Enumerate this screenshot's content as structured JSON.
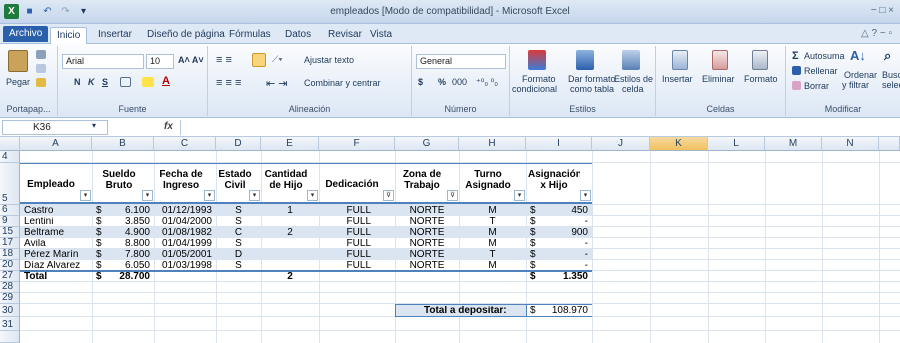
{
  "window": {
    "title": "empleados  [Modo de compatibilidad]  -  Microsoft Excel",
    "controls": "− □ ×"
  },
  "qat": {
    "excel_logo": "X",
    "save": "■",
    "undo": "↶",
    "redo": "↷",
    "customize": "▾"
  },
  "tabs": [
    "Archivo",
    "Inicio",
    "Insertar",
    "Diseño de página",
    "Fórmulas",
    "Datos",
    "Revisar",
    "Vista"
  ],
  "active_tab": "Inicio",
  "ribbon": {
    "groups": {
      "clipboard": "Portapap...",
      "font": "Fuente",
      "alignment": "Alineación",
      "number": "Número",
      "styles": "Estilos",
      "cells": "Celdas",
      "edit": "Modificar"
    },
    "paste": "Pegar",
    "font_name": "Arial",
    "font_size": "10",
    "bold": "N",
    "italic": "K",
    "underline": "S",
    "wrap_text": "Ajustar texto",
    "merge_center": "Combinar y centrar",
    "number_format": "General",
    "currency": "$",
    "percent": "%",
    "thousands": "000",
    "conditional_format_1": "Formato",
    "conditional_format_2": "condicional",
    "format_table_1": "Dar formato",
    "format_table_2": "como tabla",
    "cell_styles_1": "Estilos de",
    "cell_styles_2": "celda",
    "insert": "Insertar",
    "delete": "Eliminar",
    "format": "Formato",
    "autosum": "Autosuma",
    "fill": "Rellenar",
    "clear": "Borrar",
    "sort_1": "Ordenar",
    "sort_2": "y filtrar",
    "find_1": "Buscar y",
    "find_2": "seleccionar"
  },
  "formula_bar": {
    "name_box": "K36",
    "fx": "fx",
    "value": ""
  },
  "columns": [
    "A",
    "B",
    "C",
    "D",
    "E",
    "F",
    "G",
    "H",
    "I",
    "J",
    "K",
    "L",
    "M",
    "N"
  ],
  "selected_column": "K",
  "rows": [
    "4",
    "5",
    "6",
    "9",
    "15",
    "17",
    "18",
    "20",
    "27",
    "28",
    "29",
    "30",
    "31"
  ],
  "table": {
    "headers": [
      "Empleado",
      "Sueldo Bruto",
      "Fecha de Ingreso",
      "Estado Civil",
      "Cantidad de Hijo",
      "Dedicación",
      "Zona de Trabajo",
      "Turno Asignado",
      "Asignación x Hijo"
    ],
    "data": [
      {
        "row": "6",
        "empleado": "Castro",
        "sueldo": "6.100",
        "fecha": "01/12/1993",
        "estado": "S",
        "hijos": "1",
        "dedicacion": "FULL",
        "zona": "NORTE",
        "turno": "M",
        "asignacion": "450"
      },
      {
        "row": "9",
        "empleado": "Lentini",
        "sueldo": "3.850",
        "fecha": "01/04/2000",
        "estado": "S",
        "hijos": "",
        "dedicacion": "FULL",
        "zona": "NORTE",
        "turno": "T",
        "asignacion": "-"
      },
      {
        "row": "15",
        "empleado": "Beltrame",
        "sueldo": "4.900",
        "fecha": "01/08/1982",
        "estado": "C",
        "hijos": "2",
        "dedicacion": "FULL",
        "zona": "NORTE",
        "turno": "M",
        "asignacion": "900"
      },
      {
        "row": "17",
        "empleado": "Ávila",
        "sueldo": "8.800",
        "fecha": "01/04/1999",
        "estado": "S",
        "hijos": "",
        "dedicacion": "FULL",
        "zona": "NORTE",
        "turno": "M",
        "asignacion": "-"
      },
      {
        "row": "18",
        "empleado": "Pérez Marín",
        "sueldo": "7.800",
        "fecha": "01/05/2001",
        "estado": "D",
        "hijos": "",
        "dedicacion": "FULL",
        "zona": "NORTE",
        "turno": "T",
        "asignacion": "-"
      },
      {
        "row": "20",
        "empleado": "Díaz Alvarez",
        "sueldo": "6.050",
        "fecha": "01/03/1998",
        "estado": "S",
        "hijos": "",
        "dedicacion": "FULL",
        "zona": "NORTE",
        "turno": "M",
        "asignacion": "-"
      }
    ],
    "currency": "$",
    "total_label": "Total",
    "total_sueldo": "28.700",
    "total_hijos": "2",
    "total_asignacion": "1.350",
    "deposit_label": "Total a depositar:",
    "deposit_value": "108.970"
  },
  "colors": {
    "selected_column": "#f1c15f",
    "header_fill": "#dbe5f1",
    "file_tab": "#2a5fab"
  }
}
